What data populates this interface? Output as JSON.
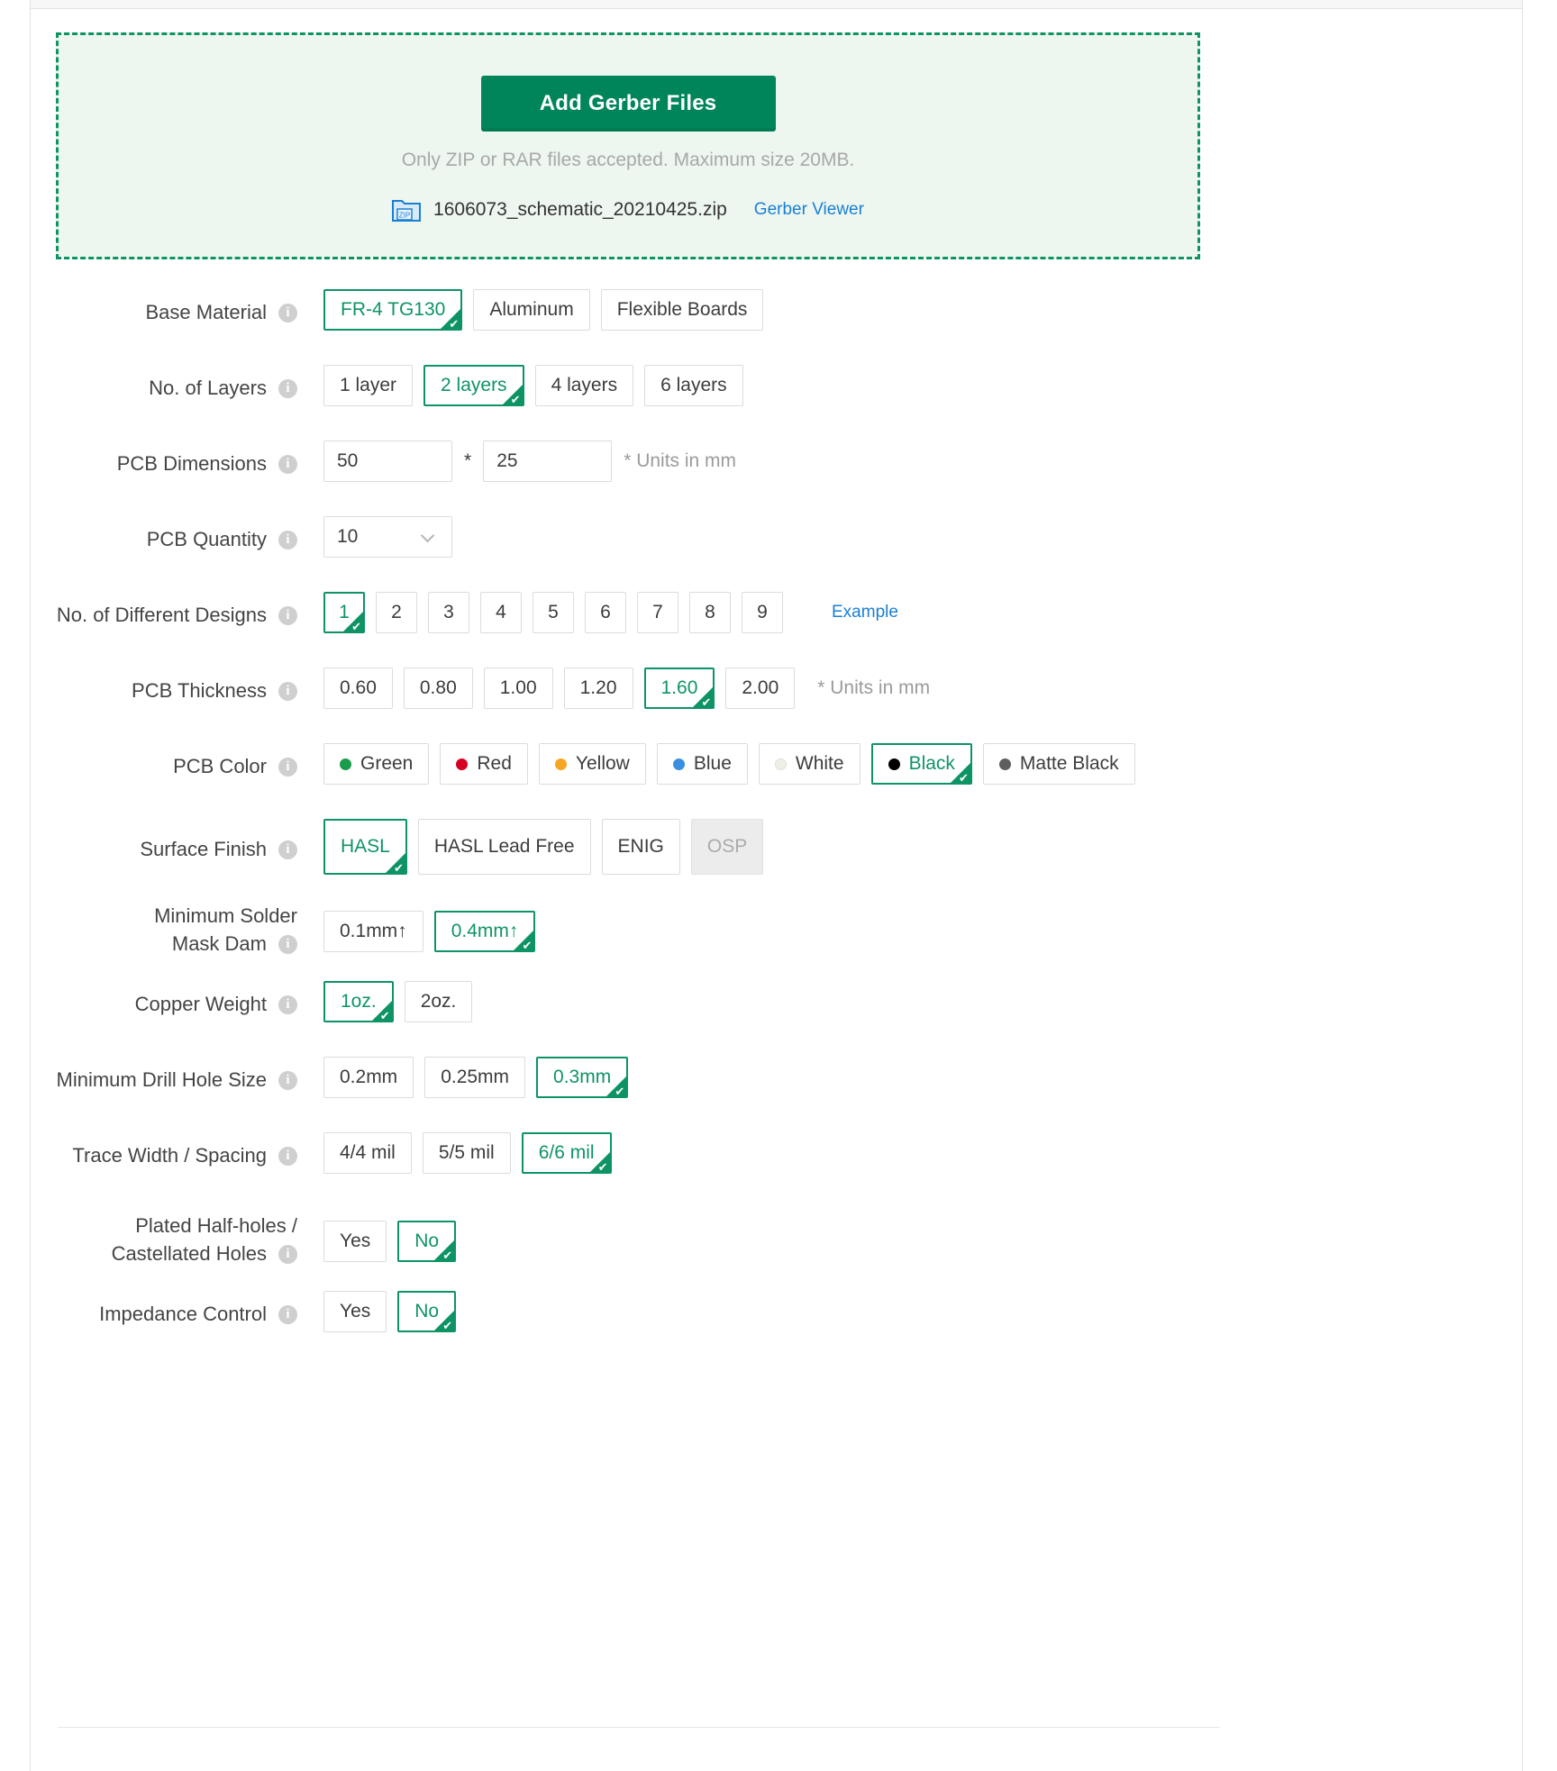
{
  "upload": {
    "button_label": "Add Gerber Files",
    "hint": "Only ZIP or RAR files accepted. Maximum size 20MB.",
    "file_icon_label": "ZIP",
    "file_name": "1606073_schematic_20210425.zip",
    "viewer_link": "Gerber Viewer"
  },
  "accent_color": "#0e9464",
  "button_color": "#00855a",
  "link_color": "#1a7fd4",
  "rows": [
    {
      "key": "base_material",
      "label": "Base Material",
      "options": [
        "FR-4 TG130",
        "Aluminum",
        "Flexible Boards"
      ],
      "selected": "FR-4 TG130"
    },
    {
      "key": "layers",
      "label": "No. of Layers",
      "options": [
        "1 layer",
        "2 layers",
        "4 layers",
        "6 layers"
      ],
      "selected": "2 layers"
    },
    {
      "key": "dimensions",
      "label": "PCB Dimensions",
      "width_value": "50",
      "separator": "*",
      "height_value": "25",
      "units_note": "* Units in mm"
    },
    {
      "key": "quantity",
      "label": "PCB Quantity",
      "value": "10"
    },
    {
      "key": "designs",
      "label": "No. of Different Designs",
      "options": [
        "1",
        "2",
        "3",
        "4",
        "5",
        "6",
        "7",
        "8",
        "9"
      ],
      "selected": "1",
      "example_link": "Example"
    },
    {
      "key": "thickness",
      "label": "PCB Thickness",
      "options": [
        "0.60",
        "0.80",
        "1.00",
        "1.20",
        "1.60",
        "2.00"
      ],
      "selected": "1.60",
      "units_note": "* Units in mm"
    },
    {
      "key": "color",
      "label": "PCB Color",
      "options": [
        {
          "label": "Green",
          "swatch": "#1a9c4b"
        },
        {
          "label": "Red",
          "swatch": "#d60024"
        },
        {
          "label": "Yellow",
          "swatch": "#f5a623"
        },
        {
          "label": "Blue",
          "swatch": "#3b8fe0"
        },
        {
          "label": "White",
          "swatch": "#efefe6"
        },
        {
          "label": "Black",
          "swatch": "#000000"
        },
        {
          "label": "Matte Black",
          "swatch": "#5e5e5e"
        }
      ],
      "selected": "Black"
    },
    {
      "key": "surface_finish",
      "label": "Surface Finish",
      "options": [
        "HASL",
        "HASL Lead Free",
        "ENIG",
        "OSP"
      ],
      "selected": "HASL",
      "disabled": [
        "OSP"
      ]
    },
    {
      "key": "solder_mask_dam",
      "label": "Minimum Solder Mask Dam",
      "label_line1": "Minimum Solder",
      "label_line2": "Mask Dam",
      "options": [
        "0.1mm↑",
        "0.4mm↑"
      ],
      "selected": "0.4mm↑"
    },
    {
      "key": "copper_weight",
      "label": "Copper Weight",
      "options": [
        "1oz.",
        "2oz."
      ],
      "selected": "1oz."
    },
    {
      "key": "drill_hole",
      "label": "Minimum Drill Hole Size",
      "options": [
        "0.2mm",
        "0.25mm",
        "0.3mm"
      ],
      "selected": "0.3mm"
    },
    {
      "key": "trace_width",
      "label": "Trace Width / Spacing",
      "options": [
        "4/4 mil",
        "5/5 mil",
        "6/6 mil"
      ],
      "selected": "6/6 mil"
    },
    {
      "key": "half_holes",
      "label": "Plated Half-holes / Castellated Holes",
      "label_line1": "Plated Half-holes /",
      "label_line2": "Castellated Holes",
      "options": [
        "Yes",
        "No"
      ],
      "selected": "No"
    },
    {
      "key": "impedance",
      "label": "Impedance Control",
      "options": [
        "Yes",
        "No"
      ],
      "selected": "No"
    }
  ]
}
